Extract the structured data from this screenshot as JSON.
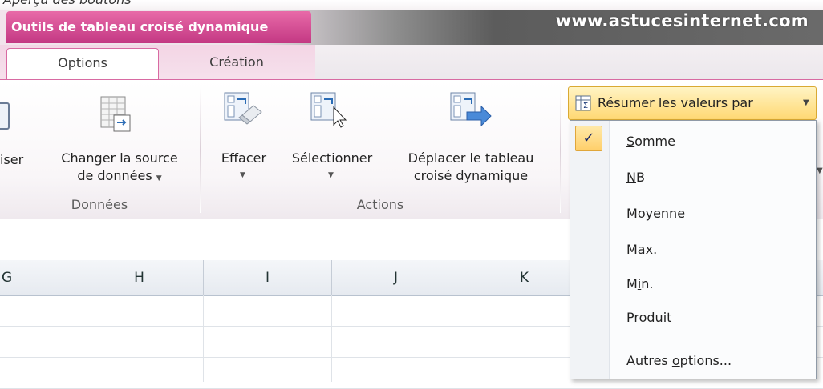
{
  "header": {
    "top_fragment": "Aperçu des boutons",
    "context_label": "Outils de tableau croisé dynamique",
    "website": "www.astucesinternet.com"
  },
  "tabs": [
    {
      "label": "Options",
      "active": true
    },
    {
      "label": "Création",
      "active": false
    }
  ],
  "ribbon": {
    "groups": {
      "donnees": {
        "label": "Données",
        "actualiser_fragment": "iser",
        "changer_source_line1": "Changer la source",
        "changer_source_line2": "de données"
      },
      "actions": {
        "label": "Actions",
        "effacer": "Effacer",
        "selectionner": "Sélectionner",
        "deplacer_line1": "Déplacer le tableau",
        "deplacer_line2": "croisé dynamique"
      }
    }
  },
  "dropdown": {
    "button_label": "Résumer les valeurs par",
    "items": [
      {
        "pre": "",
        "u": "S",
        "post": "omme",
        "checked": true
      },
      {
        "pre": "",
        "u": "N",
        "post": "B",
        "checked": false
      },
      {
        "pre": "",
        "u": "M",
        "post": "oyenne",
        "checked": false
      },
      {
        "pre": "Ma",
        "u": "x",
        "post": ".",
        "checked": false
      },
      {
        "pre": "M",
        "u": "i",
        "post": "n.",
        "checked": false
      },
      {
        "pre": "",
        "u": "P",
        "post": "roduit",
        "checked": false
      }
    ],
    "more": {
      "pre": "Autres ",
      "u": "o",
      "post": "ptions..."
    },
    "check_glyph": "✓"
  },
  "grid": {
    "columns": [
      "G",
      "H",
      "I",
      "J",
      "K"
    ]
  },
  "colors": {
    "context_pink": "#c33883",
    "accent_gold": "#ffd873",
    "ribbon_text": "#1e395b"
  }
}
